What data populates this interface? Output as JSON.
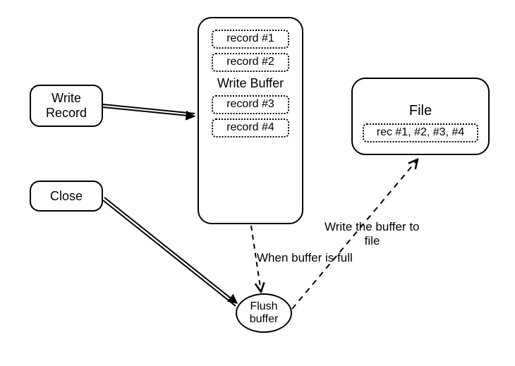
{
  "nodes": {
    "write_record": "Write\nRecord",
    "close": "Close",
    "flush": "Flush\nbuffer",
    "file_title": "File",
    "file_records": "rec #1, #2, #3, #4"
  },
  "buffer": {
    "title": "Write Buffer",
    "records": [
      "record #1",
      "record #2",
      "record #3",
      "record #4"
    ]
  },
  "annotations": {
    "buffer_full": "When buffer is full",
    "write_file": "Write the buffer to\n            file"
  }
}
